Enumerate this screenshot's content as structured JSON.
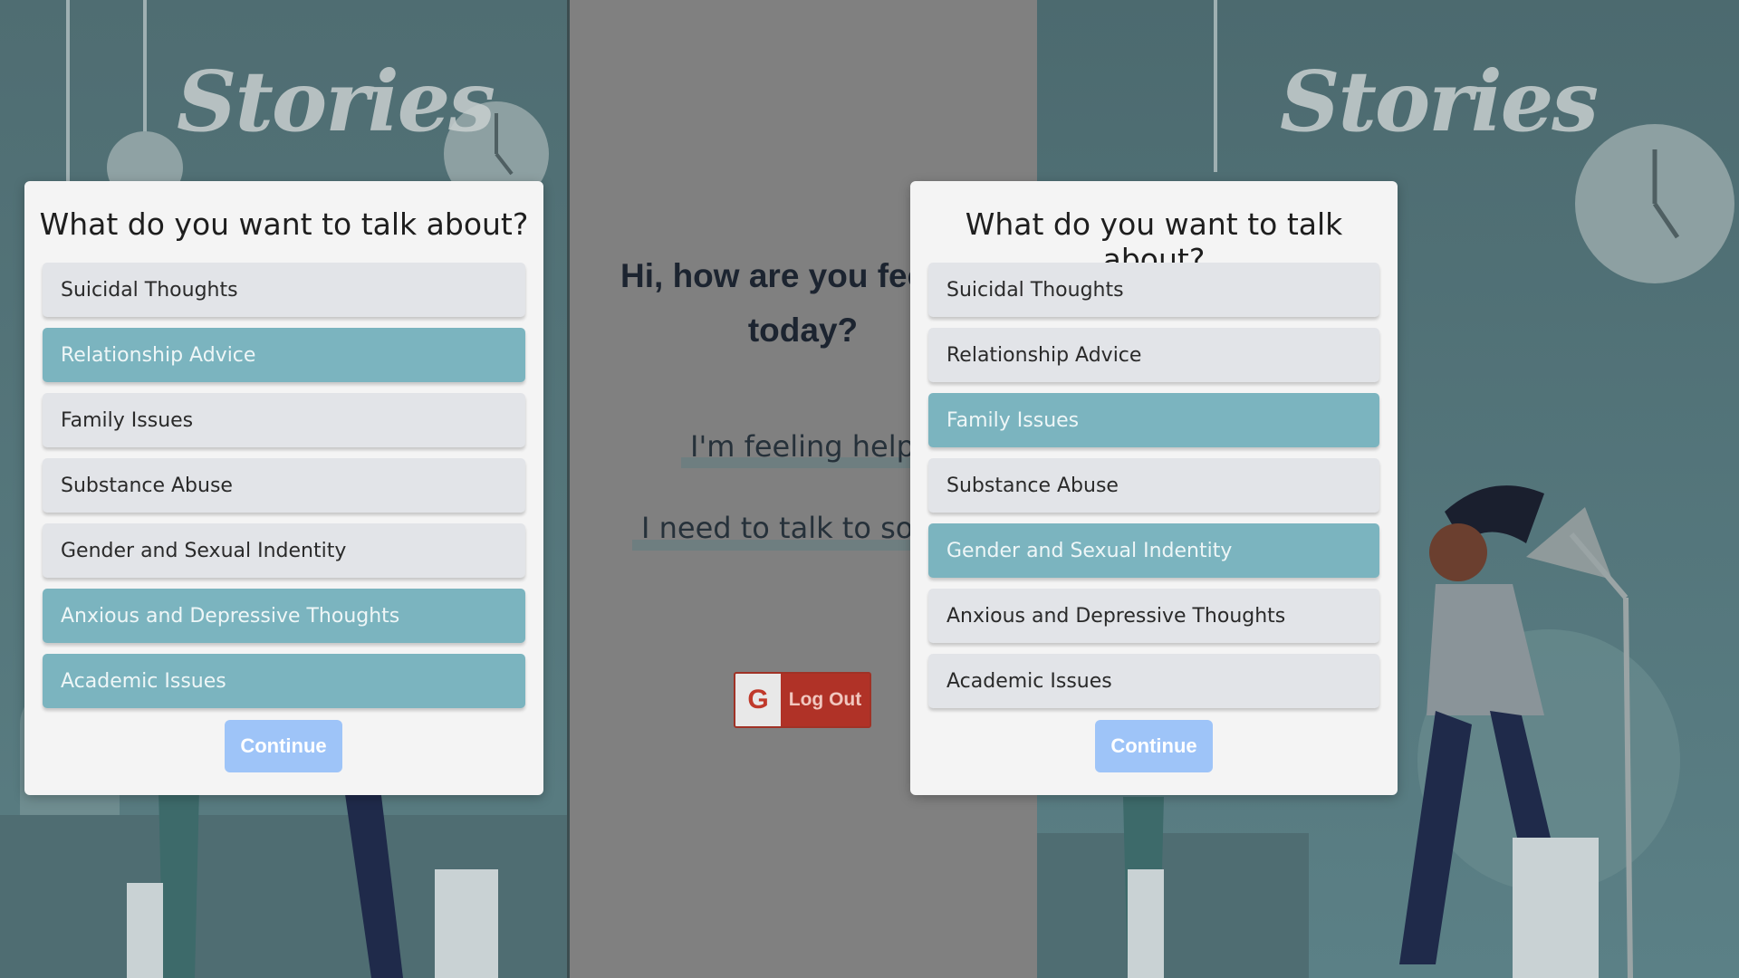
{
  "brand": {
    "logo_text": "Stories"
  },
  "home": {
    "greeting": "Hi, how are you feeling today?",
    "options": [
      "I'm feeling helpful",
      "I need to talk to someone"
    ],
    "logout": {
      "google_glyph": "G",
      "label": "Log Out"
    }
  },
  "dialogs": [
    {
      "title": "What do you want to talk about?",
      "topics": [
        {
          "label": "Suicidal Thoughts",
          "selected": false
        },
        {
          "label": "Relationship Advice",
          "selected": true
        },
        {
          "label": "Family Issues",
          "selected": false
        },
        {
          "label": "Substance Abuse",
          "selected": false
        },
        {
          "label": "Gender and Sexual Indentity",
          "selected": false
        },
        {
          "label": "Anxious and Depressive Thoughts",
          "selected": true
        },
        {
          "label": "Academic Issues",
          "selected": true
        }
      ],
      "continue_label": "Continue"
    },
    {
      "title": "What do you want to talk about?",
      "topics": [
        {
          "label": "Suicidal Thoughts",
          "selected": false
        },
        {
          "label": "Relationship Advice",
          "selected": false
        },
        {
          "label": "Family Issues",
          "selected": true
        },
        {
          "label": "Substance Abuse",
          "selected": false
        },
        {
          "label": "Gender and Sexual Indentity",
          "selected": true
        },
        {
          "label": "Anxious and Depressive Thoughts",
          "selected": false
        },
        {
          "label": "Academic Issues",
          "selected": false
        }
      ],
      "continue_label": "Continue"
    }
  ],
  "colors": {
    "selected_topic": "#7bb4bf",
    "unselected_topic": "#e2e4e8",
    "continue_button": "#9ec4f8",
    "logout_button": "#b03227"
  },
  "icons": [
    "clock-icon",
    "google-g-icon",
    "pendant-lamp-icon",
    "desk-lamp-icon",
    "plant-icon"
  ]
}
